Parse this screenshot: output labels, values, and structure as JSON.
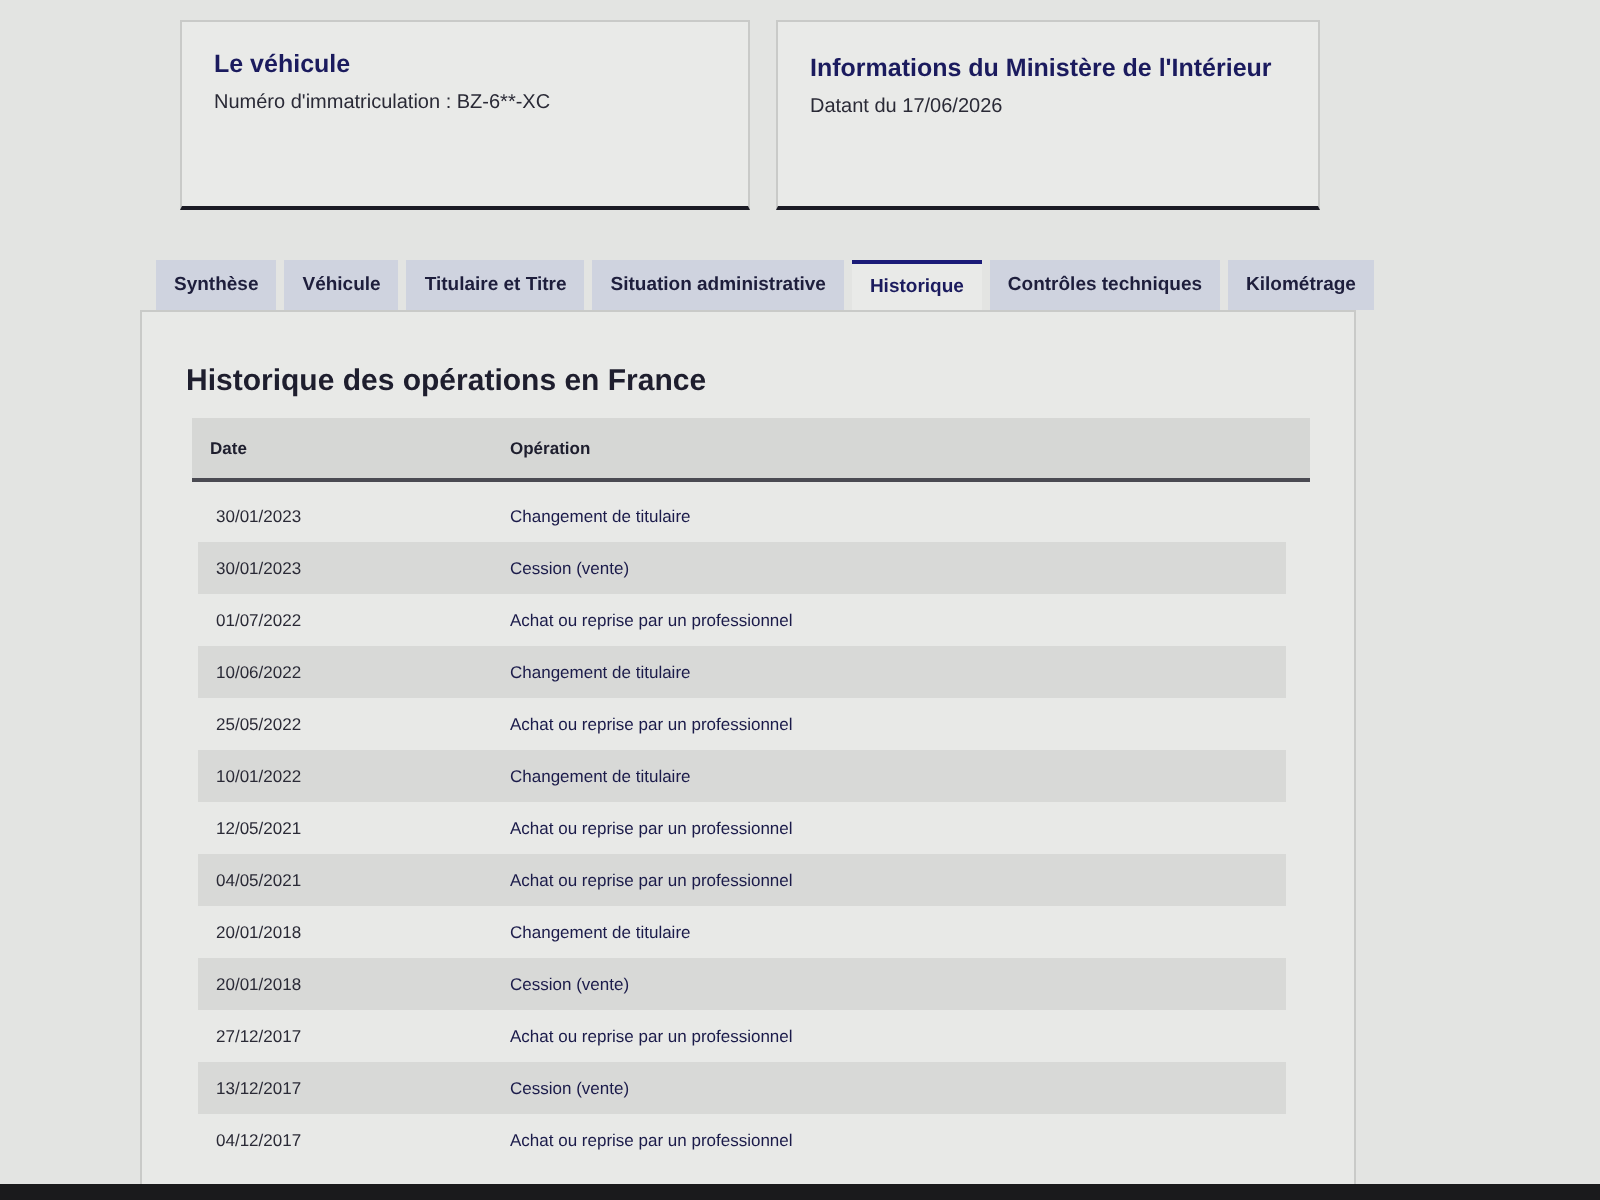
{
  "vehicle_card": {
    "title": "Le véhicule",
    "plate_text": "Numéro d'immatriculation : BZ-6**-XC"
  },
  "ministry_card": {
    "title": "Informations du Ministère de l'Intérieur",
    "date_text": "Datant du 17/06/2026"
  },
  "tabs": [
    {
      "label": "Synthèse",
      "selected": false
    },
    {
      "label": "Véhicule",
      "selected": false
    },
    {
      "label": "Titulaire et Titre",
      "selected": false
    },
    {
      "label": "Situation administrative",
      "selected": false
    },
    {
      "label": "Historique",
      "selected": true
    },
    {
      "label": "Contrôles techniques",
      "selected": false
    },
    {
      "label": "Kilométrage",
      "selected": false
    }
  ],
  "panel": {
    "heading": "Historique des opérations en France",
    "table": {
      "columns": [
        "Date",
        "Opération"
      ],
      "rows": [
        {
          "date": "30/01/2023",
          "operation": "Changement de titulaire"
        },
        {
          "date": "30/01/2023",
          "operation": "Cession (vente)"
        },
        {
          "date": "01/07/2022",
          "operation": "Achat ou reprise par un professionnel"
        },
        {
          "date": "10/06/2022",
          "operation": "Changement de titulaire"
        },
        {
          "date": "25/05/2022",
          "operation": "Achat ou reprise par un professionnel"
        },
        {
          "date": "10/01/2022",
          "operation": "Changement de titulaire"
        },
        {
          "date": "12/05/2021",
          "operation": "Achat ou reprise par un professionnel"
        },
        {
          "date": "04/05/2021",
          "operation": "Achat ou reprise par un professionnel"
        },
        {
          "date": "20/01/2018",
          "operation": "Changement de titulaire"
        },
        {
          "date": "20/01/2018",
          "operation": "Cession (vente)"
        },
        {
          "date": "27/12/2017",
          "operation": "Achat ou reprise par un professionnel"
        },
        {
          "date": "13/12/2017",
          "operation": "Cession (vente)"
        },
        {
          "date": "04/12/2017",
          "operation": "Achat ou reprise par un professionnel"
        }
      ]
    }
  }
}
